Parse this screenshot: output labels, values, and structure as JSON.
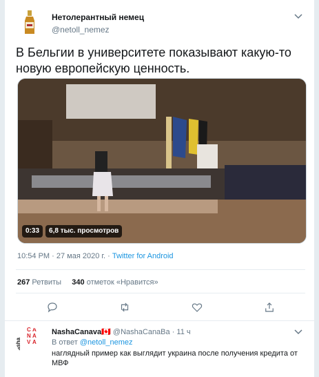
{
  "tweet": {
    "display_name": "Нетолерантный немец",
    "handle": "@netoll_nemez",
    "text": "В Бельгии в университете показывают какую-то новую европейскую ценность.",
    "video": {
      "duration": "0:33",
      "views": "6,8 тыс. просмотров"
    },
    "timestamp": "10:54 PM · 27 мая 2020 г.",
    "dot": " · ",
    "client": "Twitter for Android",
    "stats": {
      "retweets_count": "267",
      "retweets_label": " Ретвиты",
      "likes_count": "340",
      "likes_label": " отметок «Нравится»"
    },
    "icons": {
      "more": "chevron-down-icon",
      "reply": "reply-icon",
      "retweet": "retweet-icon",
      "like": "heart-icon",
      "share": "share-icon"
    }
  },
  "reply": {
    "avatar_text": "nasha CANAVA",
    "display_name": "NashaCanava",
    "flag": "🇨🇦",
    "handle": " @NashaCanaBa",
    "time": " · 11 ч",
    "reply_to_label": "В ответ ",
    "reply_to_handle": "@netoll_nemez",
    "text": "наглядный пример как выглядит украина после получения кредита от МВФ"
  },
  "colors": {
    "accent": "#1b95e0",
    "secondary_text": "#657786",
    "primary_text": "#14171a",
    "divider": "#e6ecf0"
  }
}
